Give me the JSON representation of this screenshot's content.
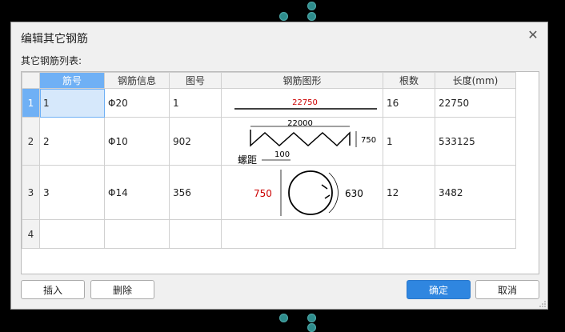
{
  "dialog": {
    "title": "编辑其它钢筋",
    "subtitle": "其它钢筋列表:"
  },
  "table": {
    "columns": [
      "筋号",
      "钢筋信息",
      "图号",
      "钢筋图形",
      "根数",
      "长度(mm)"
    ],
    "rows": [
      {
        "row": "1",
        "jinhao": "1",
        "info": "Φ20",
        "tuhao": "1",
        "shape_label": "22750",
        "count": "16",
        "length": "22750"
      },
      {
        "row": "2",
        "jinhao": "2",
        "info": "Φ10",
        "tuhao": "902",
        "shape_top": "22000",
        "shape_right": "750",
        "shape_pitch": "100",
        "shape_pitch_label": "螺距",
        "count": "1",
        "length": "533125"
      },
      {
        "row": "3",
        "jinhao": "3",
        "info": "Φ14",
        "tuhao": "356",
        "shape_left": "750",
        "shape_right": "630",
        "count": "12",
        "length": "3482"
      },
      {
        "row": "4",
        "jinhao": "",
        "info": "",
        "tuhao": "",
        "count": "",
        "length": ""
      }
    ]
  },
  "buttons": {
    "insert": "插入",
    "delete": "删除",
    "ok": "确定",
    "cancel": "取消"
  },
  "colors": {
    "accent": "#2f86e0",
    "header_active": "#6fb0f5",
    "shape_red": "#cc0000"
  }
}
